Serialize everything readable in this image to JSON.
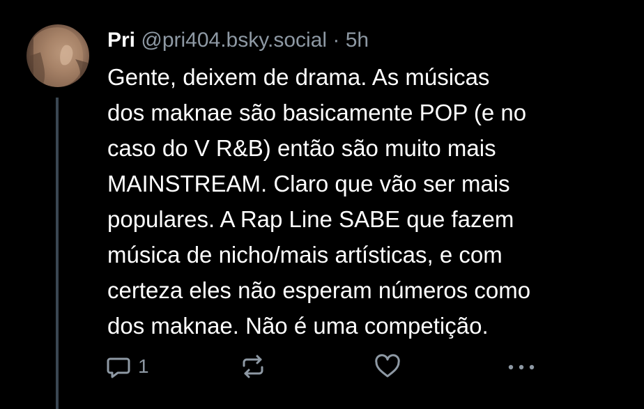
{
  "post": {
    "author": {
      "display_name": "Pri",
      "handle": "@pri404.bsky.social"
    },
    "separator": "·",
    "timestamp": "5h",
    "text_lines": [
      "Gente, deixem de drama. As músicas",
      "dos maknae são basicamente POP (e no",
      "caso do V R&B) então são muito mais",
      "MAINSTREAM. Claro que vão ser mais",
      "populares. A Rap Line SABE que fazem",
      "música de nicho/mais artísticas, e com",
      "certeza eles não esperam números como",
      "dos maknae. Não é uma competição."
    ],
    "actions": {
      "reply_icon": "speech-bubble-icon",
      "reply_count": "1",
      "repost_icon": "repost-arrows-icon",
      "like_icon": "heart-icon",
      "more_icon": "ellipsis-icon"
    }
  },
  "colors": {
    "background": "#000000",
    "text": "#ffffff",
    "muted": "#8e99a4",
    "thread_line": "#3a4652"
  }
}
